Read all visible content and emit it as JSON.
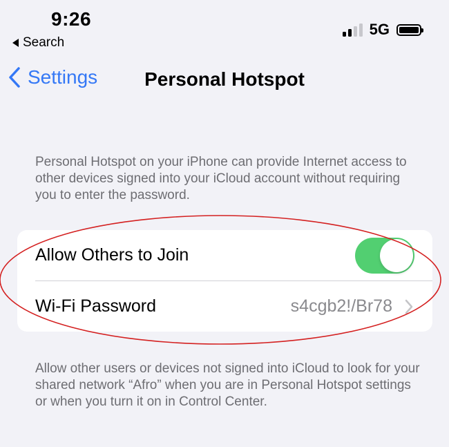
{
  "status_bar": {
    "time": "9:26",
    "back_app": "Search",
    "network": "5G"
  },
  "nav": {
    "back_label": "Settings",
    "title": "Personal Hotspot"
  },
  "description_top": "Personal Hotspot on your iPhone can provide Internet access to other devices signed into your iCloud account without requiring you to enter the password.",
  "settings": {
    "allow_others_label": "Allow Others to Join",
    "allow_others_on": true,
    "wifi_password_label": "Wi-Fi Password",
    "wifi_password_value": "s4cgb2!/Br78"
  },
  "description_bottom": "Allow other users or devices not signed into iCloud to look for your shared network “Afro” when you are in Personal Hotspot settings or when you turn it on in Control Center.",
  "colors": {
    "accent": "#3478f6",
    "toggle_on": "#34c759",
    "annotation": "#d42020",
    "background": "#f2f2f7"
  },
  "icons": [
    "back-triangle-icon",
    "signal-bars-icon",
    "battery-icon",
    "chevron-left-icon",
    "chevron-right-icon"
  ]
}
